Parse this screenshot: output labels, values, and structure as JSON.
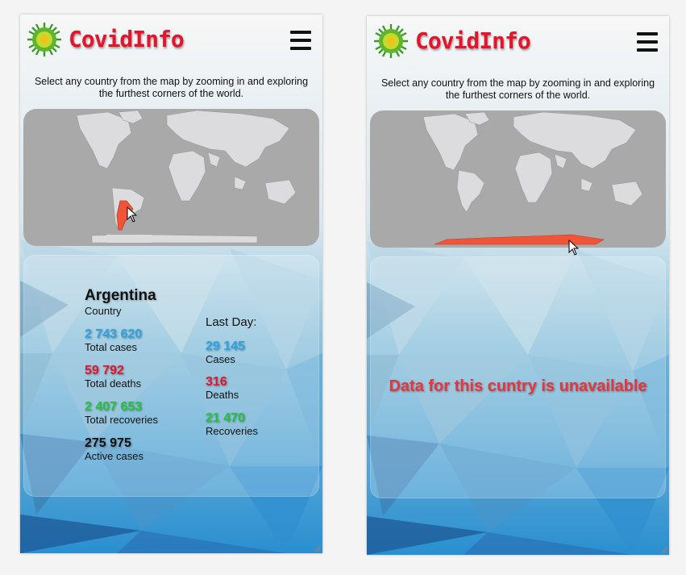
{
  "app": {
    "title": "CovidInfo",
    "logo_icon": "virus-icon",
    "menu_icon": "hamburger-menu-icon"
  },
  "intro_text": "Select any country from the map by zooming in and exploring the furthest corners of the world.",
  "colors": {
    "brand": "#e5142a",
    "cases": "#29a4e6",
    "deaths": "#e5142a",
    "recoveries": "#22c33a",
    "highlight": "#f0553a",
    "map_bg": "#a9a9aa",
    "land": "#dcdcdf"
  },
  "left": {
    "selected_country": "Argentina",
    "country_label": "Country",
    "stats": [
      {
        "value": "2 743 620",
        "label": "Total cases"
      },
      {
        "value": "59 792",
        "label": "Total deaths"
      },
      {
        "value": "2 407 653",
        "label": "Total recoveries"
      },
      {
        "value": "275 975",
        "label": "Active cases"
      }
    ],
    "last_day_title": "Last Day:",
    "last_day": [
      {
        "value": "29 145",
        "label": "Cases"
      },
      {
        "value": "316",
        "label": "Deaths"
      },
      {
        "value": "21 470",
        "label": "Recoveries"
      }
    ]
  },
  "right": {
    "selected_region": "Antarctica",
    "message": "Data for this cuntry is unavailable"
  }
}
